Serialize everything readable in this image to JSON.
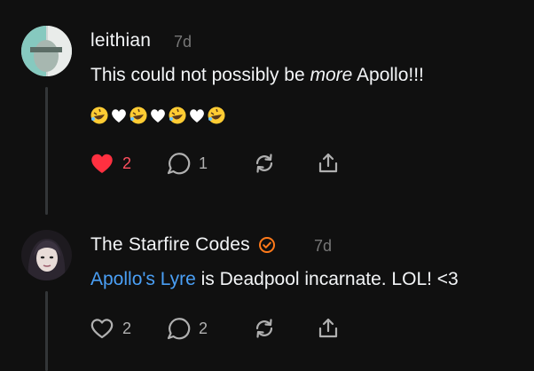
{
  "posts": [
    {
      "username": "leithian",
      "time": "7d",
      "text_before": "This could not possibly be ",
      "text_em": "more",
      "text_after": " Apollo!!!",
      "emojis": [
        "rofl-emoji",
        "white-heart-emoji",
        "rofl-emoji",
        "white-heart-emoji",
        "rofl-emoji",
        "white-heart-emoji",
        "rofl-emoji"
      ],
      "likes": "2",
      "liked": true,
      "replies": "1"
    },
    {
      "username": "The Starfire Codes",
      "verified": true,
      "time": "7d",
      "link_text": "Apollo's Lyre",
      "text_after": " is Deadpool incarnate. LOL! <3",
      "likes": "2",
      "liked": false,
      "replies": "2"
    }
  ],
  "colors": {
    "background": "#101010",
    "link": "#4a9ff5",
    "like_active": "#ff3040",
    "verified_badge": "#ff7a1a"
  }
}
